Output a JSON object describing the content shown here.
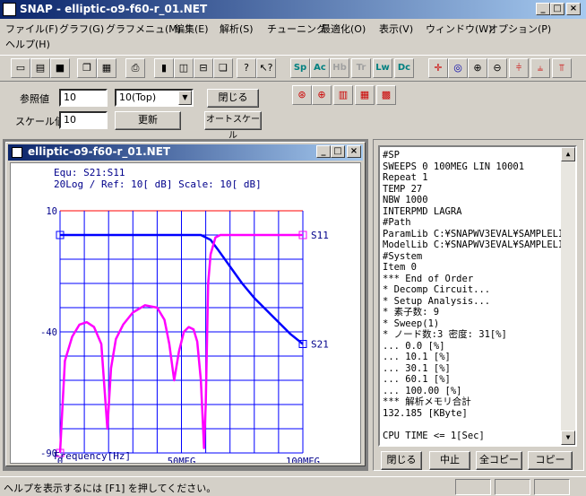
{
  "window": {
    "title": "SNAP - elliptic-o9-f60-r_01.NET"
  },
  "menu": [
    "ファイル(F)",
    "グラフ(G)",
    "グラフメニュ(M)",
    "編集(E)",
    "解析(S)",
    "チューニング",
    "最適化(O)",
    "表示(V)",
    "ウィンドウ(W)",
    "オプション(P)",
    "ヘルプ(H)"
  ],
  "toolbar": {
    "sp": "Sp",
    "ac": "Ac",
    "hb": "Hb",
    "tr": "Tr",
    "lw": "Lw",
    "dc": "Dc"
  },
  "controls": {
    "ref_label": "参照値",
    "ref_value": "10",
    "ref_select": "10(Top)",
    "scale_label": "スケール値",
    "scale_value": "10",
    "close_label": "閉じる",
    "update_label": "更新",
    "autoscale_label": "オートスケール"
  },
  "child": {
    "title": "elliptic-o9-f60-r_01.NET"
  },
  "chart_data": {
    "type": "line",
    "header": [
      "Equ: S21:S11",
      "20Log / Ref: 10[ dB]    Scale: 10[ dB]"
    ],
    "xlabel": "Frequency[Hz]",
    "xticks": [
      "0",
      "50MEG",
      "100MEG"
    ],
    "yticks": [
      "10",
      "-40",
      "-90"
    ],
    "xlim": [
      0,
      100
    ],
    "ylim": [
      -90,
      10
    ],
    "series": [
      {
        "name": "S21",
        "color": "#0000ff",
        "x": [
          0,
          10,
          20,
          30,
          40,
          50,
          58,
          62,
          65,
          70,
          75,
          80,
          85,
          90,
          95,
          100
        ],
        "y": [
          0,
          0,
          0,
          0,
          0,
          0,
          0,
          -2,
          -6,
          -13,
          -20,
          -26,
          -31,
          -36,
          -41,
          -45
        ]
      },
      {
        "name": "S11",
        "color": "#ff00ff",
        "x": [
          0,
          2,
          5,
          8,
          11,
          14,
          17,
          19.5,
          21,
          23,
          26,
          30,
          35,
          40,
          43,
          45,
          47,
          49,
          51,
          53,
          55,
          56.5,
          58,
          59.3,
          60,
          61,
          62,
          64,
          66,
          70,
          80,
          90,
          100
        ],
        "y": [
          -90,
          -52,
          -42,
          -37,
          -36,
          -38,
          -45,
          -80,
          -55,
          -43,
          -37,
          -32,
          -29,
          -30,
          -35,
          -45,
          -60,
          -48,
          -40,
          -38,
          -39,
          -44,
          -60,
          -88,
          -70,
          -20,
          -8,
          -1,
          0,
          0,
          0,
          0,
          0
        ]
      }
    ]
  },
  "log": [
    "#SP",
    "SWEEPS 0 100MEG LIN 10001",
    "Repeat 1",
    "TEMP 27",
    "NBW 1000",
    "INTERPMD LAGRA",
    "#Path",
    "ParamLib C:¥SNAPWV3EVAL¥SAMPLELIB",
    "ModelLib C:¥SNAPWV3EVAL¥SAMPLELIB",
    "#System",
    "Item 0",
    "*** End of Order",
    "* Decomp Circuit...",
    "* Setup Analysis...",
    "* 素子数: 9",
    "* Sweep(1)",
    "* ノード数:3 密度: 31[%]",
    "... 0.0 [%]",
    "... 10.1 [%]",
    "... 30.1 [%]",
    "... 60.1 [%]",
    "... 100.00 [%]",
    "*** 解析メモリ合計",
    "132.185 [KByte]",
    "",
    "CPU TIME <= 1[Sec]"
  ],
  "log_buttons": [
    "閉じる",
    "中止",
    "全コピー",
    "コピー"
  ],
  "status": {
    "text": "ヘルプを表示するには [F1] を押してください。"
  }
}
